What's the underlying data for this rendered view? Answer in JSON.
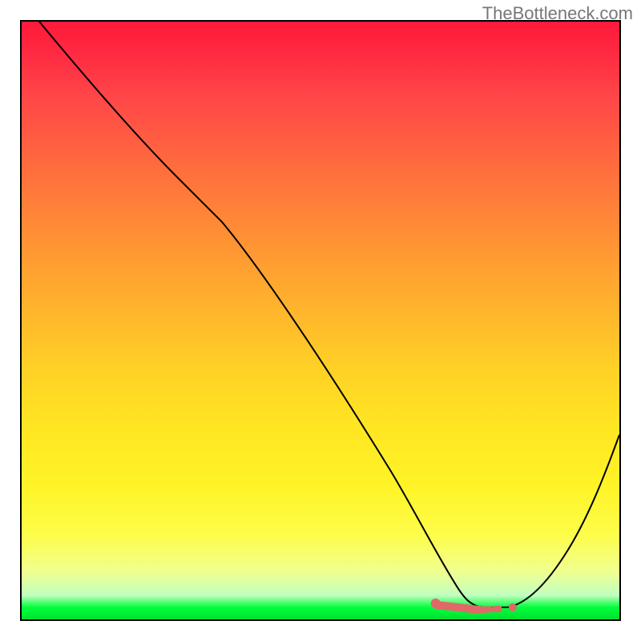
{
  "watermark": "TheBottleneck.com",
  "chart_data": {
    "type": "line",
    "title": "",
    "xlabel": "",
    "ylabel": "",
    "xlim": [
      0,
      100
    ],
    "ylim": [
      0,
      100
    ],
    "grid": false,
    "legend": false,
    "series": [
      {
        "name": "curve",
        "color": "#000000",
        "x": [
          3,
          10,
          20,
          28,
          35,
          45,
          55,
          65,
          70,
          72,
          75,
          80,
          85,
          90,
          95,
          100
        ],
        "y": [
          100,
          90,
          80,
          74,
          68,
          55,
          40,
          22,
          8,
          3,
          1,
          0.5,
          2,
          8,
          18,
          32
        ]
      },
      {
        "name": "highlight-segment",
        "color": "#e27070",
        "type": "scatter",
        "x_start": 68,
        "x_end": 82,
        "y": 3
      }
    ],
    "background": {
      "type": "gradient",
      "stops": [
        {
          "pos": 0,
          "color": "#ff1a3a"
        },
        {
          "pos": 50,
          "color": "#ffd020"
        },
        {
          "pos": 90,
          "color": "#fdff60"
        },
        {
          "pos": 98,
          "color": "#00ff3a"
        }
      ]
    }
  }
}
